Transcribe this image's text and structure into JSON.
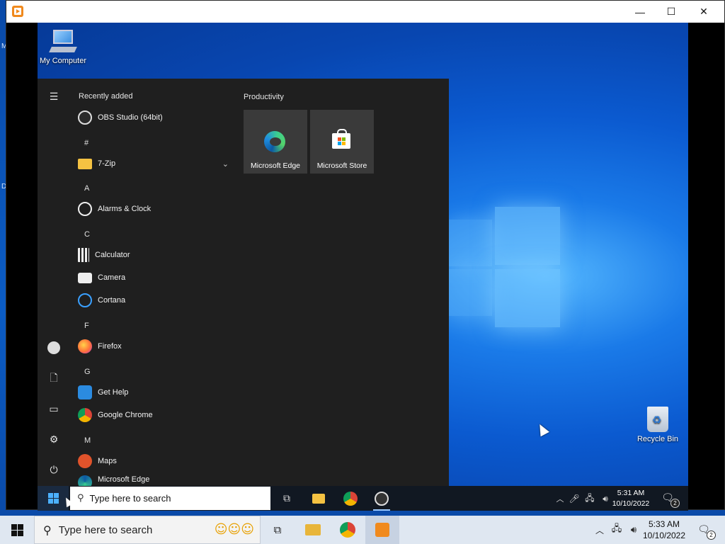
{
  "host": {
    "search_placeholder": "Type here to search",
    "clock_time": "5:33 AM",
    "clock_date": "10/10/2022",
    "notification_count": "2",
    "edge_letters": [
      "M",
      "D"
    ]
  },
  "vm_window": {
    "controls": {
      "minimize": "—",
      "maximize": "☐",
      "close": "✕"
    }
  },
  "desktop": {
    "icons": [
      {
        "label": "My Computer"
      },
      {
        "label": "Recycle Bin"
      }
    ]
  },
  "start_menu": {
    "recently_added_header": "Recently added",
    "recent_app": "OBS Studio (64bit)",
    "letters": [
      "#",
      "A",
      "C",
      "F",
      "G",
      "M"
    ],
    "apps": [
      {
        "label": "7-Zip"
      },
      {
        "label": "Alarms & Clock"
      },
      {
        "label": "Calculator"
      },
      {
        "label": "Camera"
      },
      {
        "label": "Cortana"
      },
      {
        "label": "Firefox"
      },
      {
        "label": "Get Help"
      },
      {
        "label": "Google Chrome"
      },
      {
        "label": "Maps"
      },
      {
        "label": "Microsoft Edge"
      }
    ],
    "tiles_group": "Productivity",
    "tiles": [
      {
        "label": "Microsoft Edge"
      },
      {
        "label": "Microsoft Store"
      }
    ]
  },
  "guest_taskbar": {
    "search_placeholder": "Type here to search",
    "clock_time": "5:31 AM",
    "clock_date": "10/10/2022",
    "notification_count": "2"
  },
  "colors": {
    "accent": "#0078d4",
    "start_menu_bg": "#1f1f1f",
    "tile_bg": "#3a3a3a"
  }
}
